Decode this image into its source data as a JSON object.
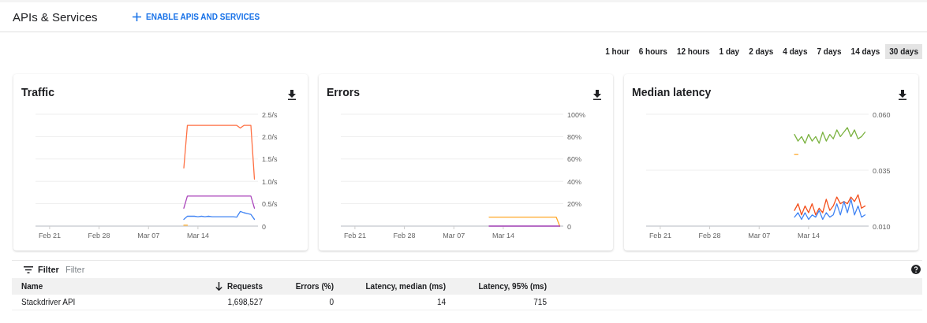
{
  "header": {
    "title": "APIs & Services",
    "action": "ENABLE APIS AND SERVICES"
  },
  "time_ranges": [
    {
      "label": "1 hour",
      "selected": false
    },
    {
      "label": "6 hours",
      "selected": false
    },
    {
      "label": "12 hours",
      "selected": false
    },
    {
      "label": "1 day",
      "selected": false
    },
    {
      "label": "2 days",
      "selected": false
    },
    {
      "label": "4 days",
      "selected": false
    },
    {
      "label": "7 days",
      "selected": false
    },
    {
      "label": "14 days",
      "selected": false
    },
    {
      "label": "30 days",
      "selected": true
    }
  ],
  "cards": [
    {
      "chart_data": {
        "type": "line",
        "grid": true,
        "title": "Traffic",
        "ylim": [
          0,
          2.5
        ],
        "categories": [
          null,
          null,
          null,
          null,
          "Feb 21",
          null,
          null,
          null,
          null,
          null,
          null,
          null,
          null,
          null,
          null,
          null,
          null,
          null,
          "Feb 28",
          null,
          null,
          null,
          null,
          null,
          null,
          null,
          null,
          null,
          null,
          null,
          null,
          null,
          "Mar 07",
          null,
          null,
          null,
          null,
          null,
          null,
          null,
          null,
          null,
          null,
          null,
          null,
          null,
          "Mar 14",
          null,
          null,
          null,
          null,
          null,
          null,
          null,
          null,
          null,
          null,
          null,
          null,
          null,
          null,
          null,
          null,
          null
        ],
        "yticks": [
          {
            "value": 0,
            "label": "0"
          },
          {
            "value": 0.5,
            "label": "0.5/s"
          },
          {
            "value": 1,
            "label": "1.0/s"
          },
          {
            "value": 1.5,
            "label": "1.5/s"
          },
          {
            "value": 2,
            "label": "2.0/s"
          },
          {
            "value": 2.5,
            "label": "2.5/s"
          }
        ],
        "series": [
          {
            "color": "#ff7043",
            "values": [
              null,
              null,
              null,
              null,
              null,
              null,
              null,
              null,
              null,
              null,
              null,
              null,
              null,
              null,
              null,
              null,
              null,
              null,
              null,
              null,
              null,
              null,
              null,
              null,
              null,
              null,
              null,
              null,
              null,
              null,
              null,
              null,
              null,
              null,
              null,
              null,
              null,
              null,
              null,
              null,
              null,
              null,
              1.3,
              2.25,
              2.25,
              2.25,
              2.25,
              2.25,
              2.25,
              2.25,
              2.25,
              2.25,
              2.25,
              2.25,
              2.25,
              2.25,
              2.25,
              2.25,
              2.19,
              2.25,
              2.25,
              2.25,
              1.05,
              null
            ]
          },
          {
            "color": "#ab47bc",
            "values": [
              null,
              null,
              null,
              null,
              null,
              null,
              null,
              null,
              null,
              null,
              null,
              null,
              null,
              null,
              null,
              null,
              null,
              null,
              null,
              null,
              null,
              null,
              null,
              null,
              null,
              null,
              null,
              null,
              null,
              null,
              null,
              null,
              null,
              null,
              null,
              null,
              null,
              null,
              null,
              null,
              null,
              null,
              0.4,
              0.67,
              0.67,
              0.67,
              0.67,
              0.67,
              0.67,
              0.67,
              0.67,
              0.67,
              0.67,
              0.67,
              0.67,
              0.67,
              0.67,
              0.67,
              0.67,
              0.67,
              0.67,
              0.67,
              0.4,
              null
            ]
          },
          {
            "color": "#4285f4",
            "values": [
              null,
              null,
              null,
              null,
              null,
              null,
              null,
              null,
              null,
              null,
              null,
              null,
              null,
              null,
              null,
              null,
              null,
              null,
              null,
              null,
              null,
              null,
              null,
              null,
              null,
              null,
              null,
              null,
              null,
              null,
              null,
              null,
              null,
              null,
              null,
              null,
              null,
              null,
              null,
              null,
              null,
              null,
              0.15,
              0.22,
              0.22,
              0.22,
              0.21,
              0.22,
              0.21,
              0.22,
              0.21,
              0.21,
              0.21,
              0.21,
              0.21,
              0.21,
              0.21,
              0.2,
              0.33,
              0.3,
              0.28,
              0.26,
              0.15,
              null
            ]
          },
          {
            "color": "#f9a825",
            "values": [
              null,
              null,
              null,
              null,
              null,
              null,
              null,
              null,
              null,
              null,
              null,
              null,
              null,
              null,
              null,
              null,
              null,
              null,
              null,
              null,
              null,
              null,
              null,
              null,
              null,
              null,
              null,
              null,
              null,
              null,
              null,
              null,
              null,
              null,
              null,
              null,
              null,
              null,
              null,
              null,
              null,
              null,
              0.02,
              0.02,
              null,
              null,
              null,
              null,
              null,
              null,
              null,
              null,
              null,
              null,
              null,
              null,
              null,
              null,
              null,
              null,
              null,
              null,
              null,
              null
            ]
          }
        ]
      }
    },
    {
      "chart_data": {
        "type": "line",
        "grid": true,
        "title": "Errors",
        "ylim": [
          0,
          100
        ],
        "categories": [
          null,
          null,
          null,
          null,
          "Feb 21",
          null,
          null,
          null,
          null,
          null,
          null,
          null,
          null,
          null,
          null,
          null,
          null,
          null,
          "Feb 28",
          null,
          null,
          null,
          null,
          null,
          null,
          null,
          null,
          null,
          null,
          null,
          null,
          null,
          "Mar 07",
          null,
          null,
          null,
          null,
          null,
          null,
          null,
          null,
          null,
          null,
          null,
          null,
          null,
          "Mar 14",
          null,
          null,
          null,
          null,
          null,
          null,
          null,
          null,
          null,
          null,
          null,
          null,
          null,
          null,
          null,
          null,
          null
        ],
        "yticks": [
          {
            "value": 0,
            "label": "0"
          },
          {
            "value": 20,
            "label": "20%"
          },
          {
            "value": 40,
            "label": "40%"
          },
          {
            "value": 60,
            "label": "60%"
          },
          {
            "value": 80,
            "label": "80%"
          },
          {
            "value": 100,
            "label": "100%"
          }
        ],
        "series": [
          {
            "color": "#ffa726",
            "values": [
              null,
              null,
              null,
              null,
              null,
              null,
              null,
              null,
              null,
              null,
              null,
              null,
              null,
              null,
              null,
              null,
              null,
              null,
              null,
              null,
              null,
              null,
              null,
              null,
              null,
              null,
              null,
              null,
              null,
              null,
              null,
              null,
              null,
              null,
              null,
              null,
              null,
              null,
              null,
              null,
              null,
              null,
              8,
              8,
              8,
              8,
              8,
              8,
              8,
              8,
              8,
              8,
              8,
              8,
              8,
              8,
              8,
              8,
              8,
              8,
              8,
              8,
              0,
              null
            ]
          },
          {
            "color": "#ab47bc",
            "values": [
              null,
              null,
              null,
              null,
              null,
              null,
              null,
              null,
              null,
              null,
              null,
              null,
              null,
              null,
              null,
              null,
              null,
              null,
              null,
              null,
              null,
              null,
              null,
              null,
              null,
              null,
              null,
              null,
              null,
              null,
              null,
              null,
              null,
              null,
              null,
              null,
              null,
              null,
              null,
              null,
              null,
              null,
              0,
              0,
              0,
              0,
              0,
              0,
              0,
              0,
              0,
              0,
              0,
              0,
              0,
              0,
              0,
              0,
              0,
              0,
              0,
              0,
              0,
              null
            ]
          }
        ]
      }
    },
    {
      "chart_data": {
        "type": "line",
        "grid": true,
        "title": "Median latency",
        "ylim": [
          0.01,
          0.06
        ],
        "categories": [
          null,
          null,
          null,
          null,
          "Feb 21",
          null,
          null,
          null,
          null,
          null,
          null,
          null,
          null,
          null,
          null,
          null,
          null,
          null,
          "Feb 28",
          null,
          null,
          null,
          null,
          null,
          null,
          null,
          null,
          null,
          null,
          null,
          null,
          null,
          "Mar 07",
          null,
          null,
          null,
          null,
          null,
          null,
          null,
          null,
          null,
          null,
          null,
          null,
          null,
          "Mar 14",
          null,
          null,
          null,
          null,
          null,
          null,
          null,
          null,
          null,
          null,
          null,
          null,
          null,
          null,
          null,
          null,
          null
        ],
        "yticks": [
          {
            "value": 0.01,
            "label": "0.010"
          },
          {
            "value": 0.035,
            "label": "0.035"
          },
          {
            "value": 0.06,
            "label": "0.060"
          }
        ],
        "series": [
          {
            "color": "#7cb342",
            "values": [
              null,
              null,
              null,
              null,
              null,
              null,
              null,
              null,
              null,
              null,
              null,
              null,
              null,
              null,
              null,
              null,
              null,
              null,
              null,
              null,
              null,
              null,
              null,
              null,
              null,
              null,
              null,
              null,
              null,
              null,
              null,
              null,
              null,
              null,
              null,
              null,
              null,
              null,
              null,
              null,
              null,
              null,
              0.051,
              0.048,
              0.05,
              0.047,
              0.051,
              0.048,
              0.05,
              0.047,
              0.052,
              0.048,
              0.051,
              0.049,
              0.053,
              0.05,
              0.052,
              0.054,
              0.05,
              0.053,
              0.049,
              0.05,
              0.052,
              null
            ]
          },
          {
            "color": "#ffa726",
            "values": [
              null,
              null,
              null,
              null,
              null,
              null,
              null,
              null,
              null,
              null,
              null,
              null,
              null,
              null,
              null,
              null,
              null,
              null,
              null,
              null,
              null,
              null,
              null,
              null,
              null,
              null,
              null,
              null,
              null,
              null,
              null,
              null,
              null,
              null,
              null,
              null,
              null,
              null,
              null,
              null,
              null,
              null,
              0.042,
              0.042,
              null,
              null,
              null,
              null,
              null,
              null,
              null,
              null,
              null,
              null,
              null,
              null,
              null,
              null,
              null,
              null,
              null,
              null,
              null,
              null
            ]
          },
          {
            "color": "#f4511e",
            "values": [
              null,
              null,
              null,
              null,
              null,
              null,
              null,
              null,
              null,
              null,
              null,
              null,
              null,
              null,
              null,
              null,
              null,
              null,
              null,
              null,
              null,
              null,
              null,
              null,
              null,
              null,
              null,
              null,
              null,
              null,
              null,
              null,
              null,
              null,
              null,
              null,
              null,
              null,
              null,
              null,
              null,
              null,
              0.017,
              0.02,
              0.015,
              0.019,
              0.016,
              0.02,
              0.015,
              0.018,
              0.016,
              0.022,
              0.017,
              0.019,
              0.023,
              0.02,
              0.021,
              0.02,
              0.023,
              0.021,
              0.024,
              0.018,
              0.019,
              null
            ]
          },
          {
            "color": "#4285f4",
            "values": [
              null,
              null,
              null,
              null,
              null,
              null,
              null,
              null,
              null,
              null,
              null,
              null,
              null,
              null,
              null,
              null,
              null,
              null,
              null,
              null,
              null,
              null,
              null,
              null,
              null,
              null,
              null,
              null,
              null,
              null,
              null,
              null,
              null,
              null,
              null,
              null,
              null,
              null,
              null,
              null,
              null,
              null,
              0.014,
              0.016,
              0.013,
              0.016,
              0.013,
              0.015,
              0.014,
              0.017,
              0.013,
              0.016,
              0.014,
              0.015,
              0.02,
              0.015,
              0.021,
              0.016,
              0.022,
              0.015,
              0.019,
              0.014,
              0.015,
              null
            ]
          }
        ]
      }
    }
  ],
  "filter": {
    "label": "Filter",
    "placeholder": "Filter"
  },
  "table": {
    "columns": [
      {
        "label": "Name",
        "sorted": false
      },
      {
        "label": "Requests",
        "sorted": true
      },
      {
        "label": "Errors (%)",
        "sorted": false
      },
      {
        "label": "Latency, median (ms)",
        "sorted": false
      },
      {
        "label": "Latency, 95% (ms)",
        "sorted": false
      }
    ],
    "rows": [
      [
        "Stackdriver API",
        "1,698,527",
        "0",
        "14",
        "715"
      ]
    ]
  }
}
